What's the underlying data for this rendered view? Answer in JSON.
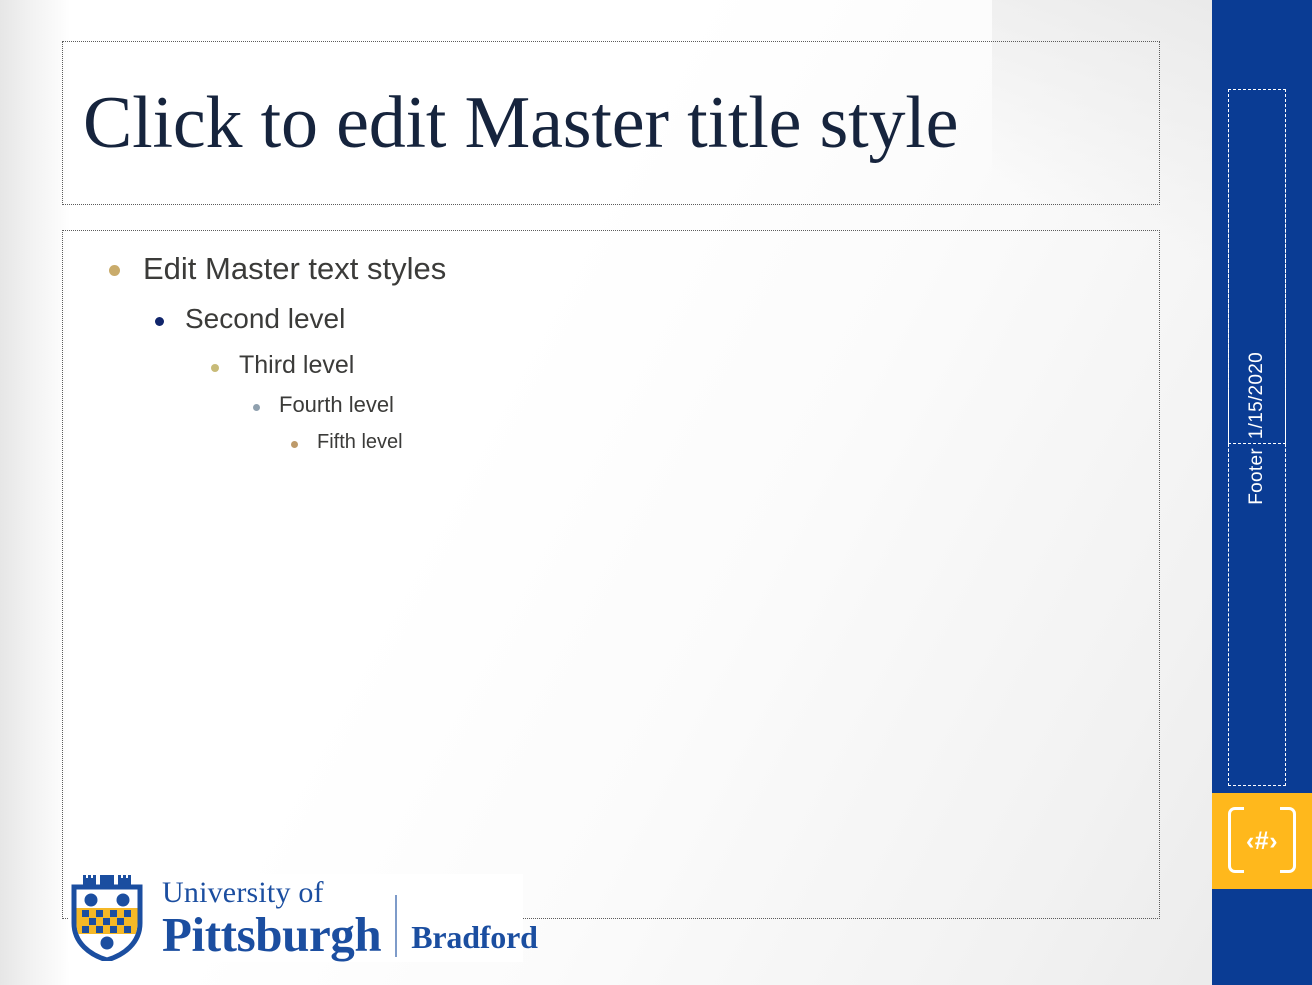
{
  "slide": {
    "title_placeholder": "Click to edit Master title style",
    "body_levels": [
      {
        "level": 1,
        "text": "Edit Master text styles",
        "bullet_color": "#c9ab6b"
      },
      {
        "level": 2,
        "text": "Second level",
        "bullet_color": "#10256b"
      },
      {
        "level": 3,
        "text": "Third level",
        "bullet_color": "#c8bb78"
      },
      {
        "level": 4,
        "text": "Fourth level",
        "bullet_color": "#8fa0ae"
      },
      {
        "level": 5,
        "text": "Fifth level",
        "bullet_color": "#bd9a6a"
      }
    ]
  },
  "sidebar": {
    "date_placeholder": "1/15/2020",
    "footer_placeholder": "Footer",
    "slide_number_placeholder": "‹#›",
    "bar_color": "#0a3c94",
    "number_block_color": "#ffb81c"
  },
  "logo": {
    "shield_icon": "pitt-shield-icon",
    "line_university": "University of",
    "line_pittsburgh": "Pittsburgh",
    "campus": "Bradford",
    "brand_blue": "#1b4ea0",
    "brand_gold": "#f5b826"
  },
  "theme": {
    "title_color": "#16243d",
    "body_color": "#3b3b39"
  }
}
